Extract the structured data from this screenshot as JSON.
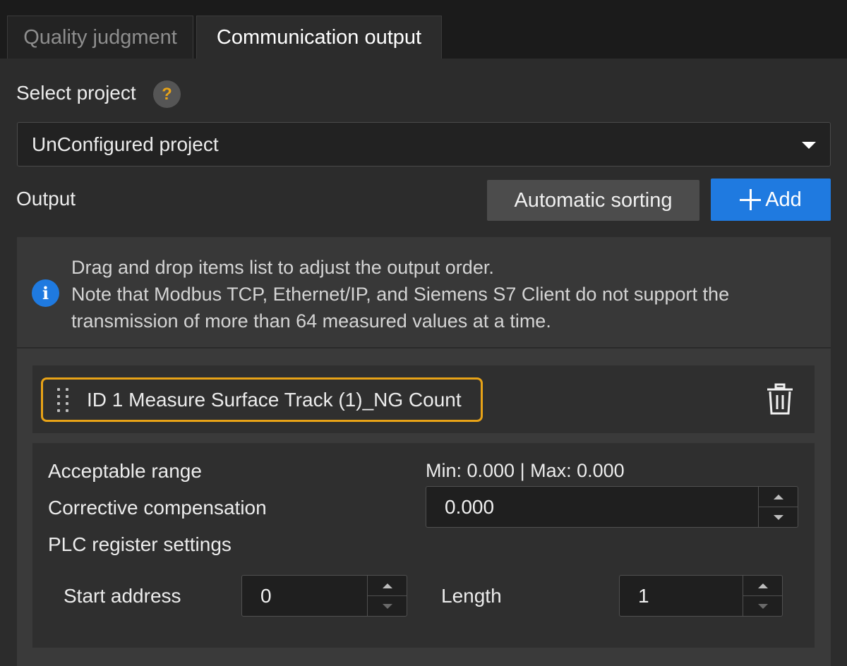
{
  "tabs": [
    {
      "label": "Quality judgment",
      "active": false
    },
    {
      "label": "Communication output",
      "active": true
    }
  ],
  "select_project": {
    "label": "Select project",
    "help_icon": "?",
    "value": "UnConfigured project"
  },
  "output": {
    "label": "Output",
    "sort_button": "Automatic sorting",
    "add_button": "Add"
  },
  "info": {
    "icon": "i",
    "line1": "Drag and drop items list to adjust the output order.",
    "line2": "Note that Modbus TCP, Ethernet/IP, and Siemens S7 Client do not support the transmission of more than 64 measured values at a time."
  },
  "item": {
    "label": "ID 1  Measure Surface Track (1)_NG Count"
  },
  "details": {
    "acceptable_range_label": "Acceptable range",
    "acceptable_range_value": "Min: 0.000 | Max: 0.000",
    "corrective_label": "Corrective compensation",
    "corrective_value": "0.000",
    "plc_label": "PLC register settings",
    "start_address_label": "Start address",
    "start_address_value": "0",
    "length_label": "Length",
    "length_value": "1"
  },
  "colors": {
    "accent": "#1f7ae0",
    "highlight": "#e8a317",
    "background": "#2c2c2c"
  }
}
